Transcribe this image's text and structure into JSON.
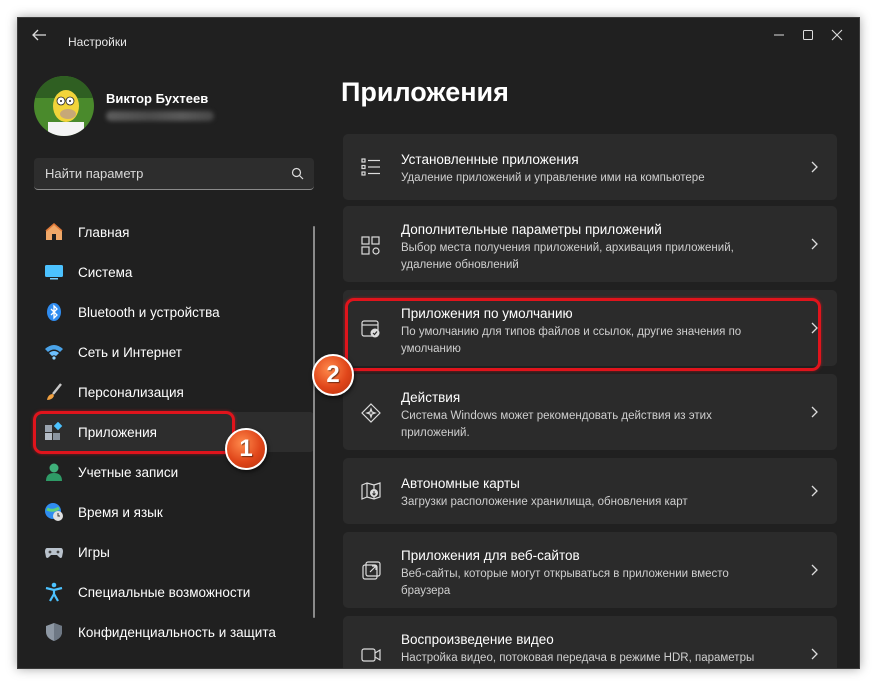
{
  "window": {
    "title": "Настройки"
  },
  "user": {
    "name": "Виктор Бухтеев"
  },
  "search": {
    "placeholder": "Найти параметр"
  },
  "sidebar": {
    "items": [
      {
        "label": "Главная",
        "icon": "home-icon"
      },
      {
        "label": "Система",
        "icon": "monitor-icon"
      },
      {
        "label": "Bluetooth и устройства",
        "icon": "bluetooth-icon"
      },
      {
        "label": "Сеть и Интернет",
        "icon": "wifi-icon"
      },
      {
        "label": "Персонализация",
        "icon": "brush-icon"
      },
      {
        "label": "Приложения",
        "icon": "apps-icon",
        "active": true
      },
      {
        "label": "Учетные записи",
        "icon": "account-icon"
      },
      {
        "label": "Время и язык",
        "icon": "globe-clock-icon"
      },
      {
        "label": "Игры",
        "icon": "gamepad-icon"
      },
      {
        "label": "Специальные возможности",
        "icon": "accessibility-icon"
      },
      {
        "label": "Конфиденциальность и защита",
        "icon": "shield-icon"
      }
    ]
  },
  "main": {
    "title": "Приложения",
    "cards": [
      {
        "title": "Установленные приложения",
        "desc": "Удаление приложений и управление ими на компьютере",
        "icon": "list-icon"
      },
      {
        "title": "Дополнительные параметры приложений",
        "desc": "Выбор места получения приложений, архивация приложений, удаление обновлений",
        "icon": "apps-settings-icon"
      },
      {
        "title": "Приложения по умолчанию",
        "desc": "По умолчанию для типов файлов и ссылок, другие значения по умолчанию",
        "icon": "default-apps-icon"
      },
      {
        "title": "Действия",
        "desc": "Система Windows может рекомендовать действия из этих приложений.",
        "icon": "actions-icon"
      },
      {
        "title": "Автономные карты",
        "desc": "Загрузки расположение хранилища, обновления карт",
        "icon": "map-icon"
      },
      {
        "title": "Приложения для веб-сайтов",
        "desc": "Веб-сайты, которые могут открываться в приложении вместо браузера",
        "icon": "open-external-icon"
      },
      {
        "title": "Воспроизведение видео",
        "desc": "Настройка видео, потоковая передача в режиме HDR, параметры",
        "icon": "video-icon"
      }
    ]
  },
  "annotations": {
    "step1": "1",
    "step2": "2"
  },
  "colors": {
    "accent": "#4cc2ff",
    "highlight": "#e0141c",
    "background": "#202020",
    "card": "#2b2b2b"
  }
}
